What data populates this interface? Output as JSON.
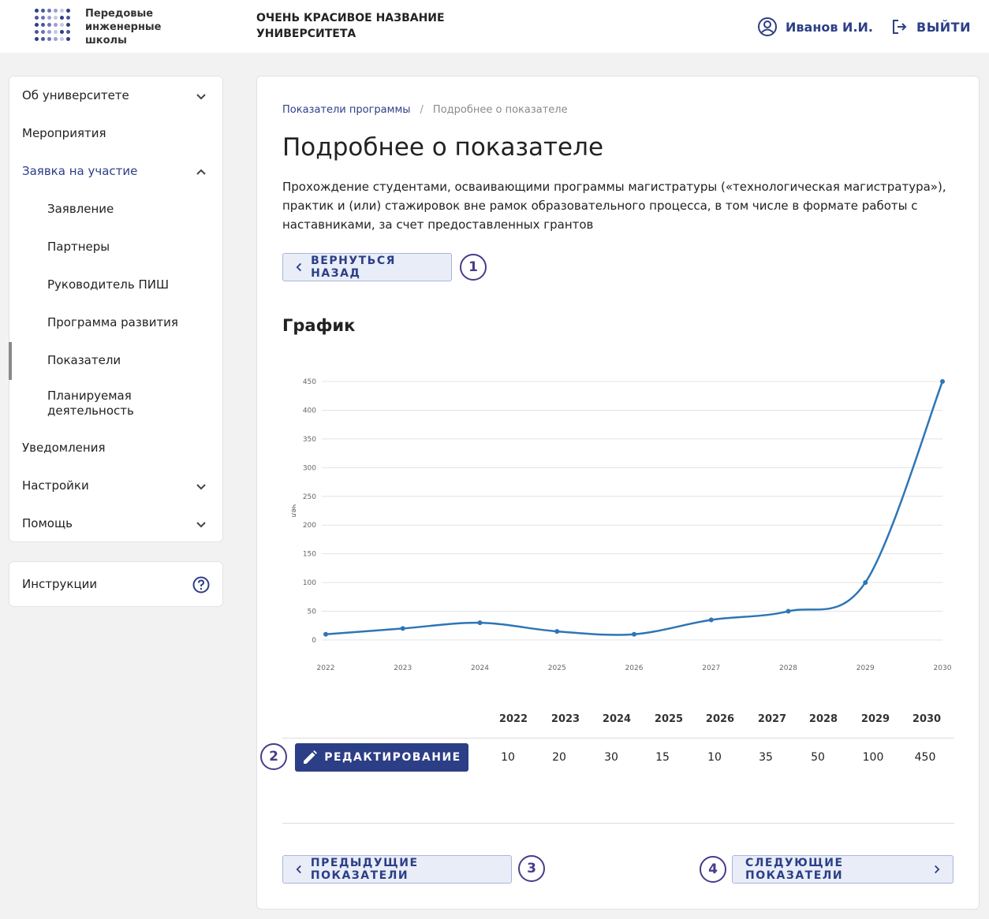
{
  "header": {
    "logo_text": "Передовые инженерные школы",
    "university_title": "ОЧЕНЬ КРАСИВОЕ НАЗВАНИЕ УНИВЕРСИТЕТА",
    "user_name": "Иванов И.И.",
    "logout_label": "ВЫЙТИ"
  },
  "sidebar": {
    "items": [
      {
        "label": "Об университете"
      },
      {
        "label": "Мероприятия"
      },
      {
        "label": "Заявка на участие"
      },
      {
        "label": "Заявление"
      },
      {
        "label": "Партнеры"
      },
      {
        "label": "Руководитель ПИШ"
      },
      {
        "label": "Программа развития"
      },
      {
        "label": "Показатели"
      },
      {
        "label": "Планируемая деятельность"
      },
      {
        "label": "Уведомления"
      },
      {
        "label": "Настройки"
      },
      {
        "label": "Помощь"
      }
    ],
    "instructions_label": "Инструкции"
  },
  "main": {
    "breadcrumb": {
      "parent": "Показатели программы",
      "separator": "/",
      "current": "Подробнее о показателе"
    },
    "title": "Подробнее о показателе",
    "description": "Прохождение студентами, осваивающими программы магистратуры («технологическая магистратура»), практик и (или) стажировок вне рамок образовательного процесса, в том числе в формате работы с наставниками, за счет предоставленных грантов",
    "back_label": "ВЕРНУТЬСЯ НАЗАД",
    "chart_heading": "График",
    "edit_label": "РЕДАКТИРОВАНИЕ",
    "prev_label": "ПРЕДЫДУЩИЕ ПОКАЗАТЕЛИ",
    "next_label": "СЛЕДУЮЩИЕ ПОКАЗАТЕЛИ",
    "badges": [
      "1",
      "2",
      "3",
      "4"
    ],
    "table": {
      "years": [
        "2022",
        "2023",
        "2024",
        "2025",
        "2026",
        "2027",
        "2028",
        "2029",
        "2030"
      ],
      "values": [
        "10",
        "20",
        "30",
        "15",
        "10",
        "35",
        "50",
        "100",
        "450"
      ]
    }
  },
  "colors": {
    "accent": "#2c3e86",
    "badge": "#4a3a8c",
    "line": "#2e75b6"
  },
  "chart_data": {
    "type": "line",
    "x": [
      2022,
      2023,
      2024,
      2025,
      2026,
      2027,
      2028,
      2029,
      2030
    ],
    "series": [
      {
        "values": [
          10,
          20,
          30,
          15,
          10,
          35,
          50,
          100,
          450
        ]
      }
    ],
    "xticks": [
      "2022",
      "2023",
      "2024",
      "2025",
      "2026",
      "2027",
      "2028",
      "2029",
      "2030"
    ],
    "yticks": [
      "0",
      "50",
      "100",
      "150",
      "200",
      "250",
      "300",
      "350",
      "400",
      "450"
    ],
    "ylabel": "чел",
    "ylim": [
      0,
      450
    ],
    "grid": true
  }
}
